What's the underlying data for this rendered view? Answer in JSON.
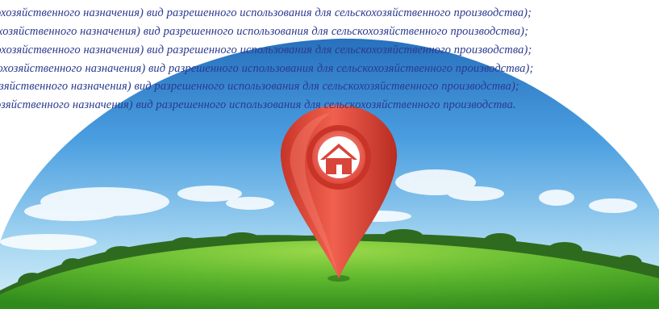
{
  "overlay_text": {
    "line1": "охозяйственного назначения) вид разрешенного использования для сельскохозяйственного производства);",
    "line2": "охозяйственного назначения) вид разрешенного использования для сельскохозяйственного производства);",
    "line3": "кохозяйственного назначения) вид разрешенного использования для сельскохозяйственного производства);",
    "line4": "кохозяйственного назначения) вид разрешенного использования для сельскохозяйственного производства);",
    "line5": "озяйственного назначения) вид разрешенного использования для сельскохозяйственного производства);",
    "line6": "озяйственного назначения) вид разрешенного использования для сельскохозяйственного производства."
  },
  "icons": {
    "pin": "location-pin-icon",
    "house": "house-icon"
  },
  "colors": {
    "text": "#2b3a8f",
    "sky_top": "#1f6fc0",
    "sky_bottom": "#bfe3f5",
    "grass": "#4caf2a",
    "pin": "#e04a3c"
  }
}
